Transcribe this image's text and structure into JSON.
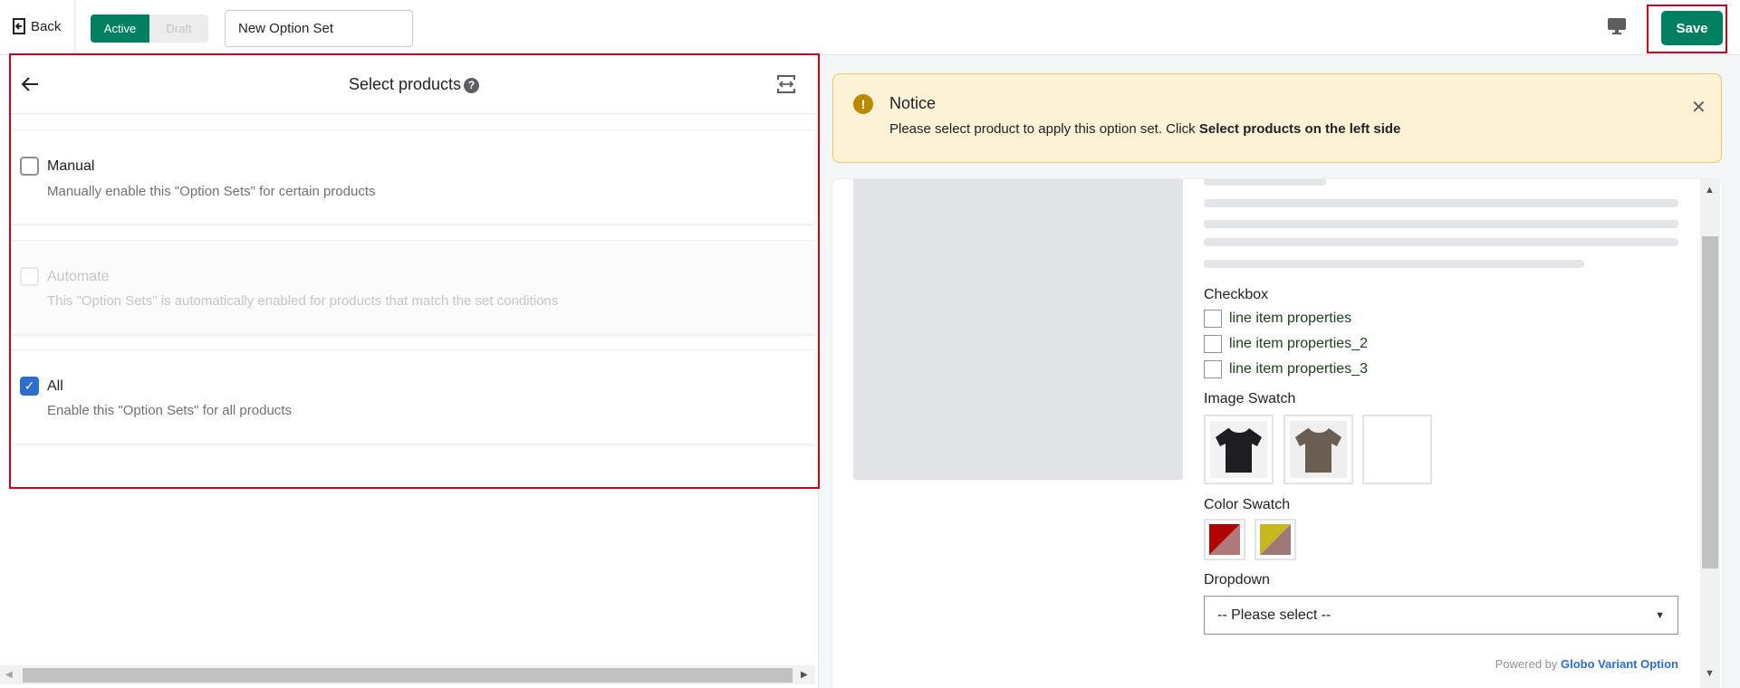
{
  "topbar": {
    "back_label": "Back",
    "status_toggle": {
      "active_label": "Active",
      "draft_label": "Draft",
      "selected": "Active"
    },
    "name_input_value": "New Option Set",
    "save_label": "Save",
    "accent_color": "#008060"
  },
  "left_panel": {
    "title": "Select products",
    "options": [
      {
        "label": "Manual",
        "description": "Manually enable this \"Option Sets\" for certain products",
        "checked": false,
        "disabled": false
      },
      {
        "label": "Automate",
        "description": "This \"Option Sets\" is automatically enabled for products that match the set conditions",
        "checked": false,
        "disabled": true
      },
      {
        "label": "All",
        "description": "Enable this \"Option Sets\" for all products",
        "checked": true,
        "disabled": false
      }
    ]
  },
  "notice": {
    "title": "Notice",
    "text": "Please select product to apply this option set. Click ",
    "text_bold": "Select products on the left side"
  },
  "preview": {
    "checkbox_title": "Checkbox",
    "checkbox_items": [
      "line item properties",
      "line item properties_2",
      "line item properties_3"
    ],
    "image_swatch_title": "Image Swatch",
    "color_swatch_title": "Color Swatch",
    "color_swatches": [
      [
        "#b00000",
        "#b07878"
      ],
      [
        "#c8b820",
        "#a07878"
      ]
    ],
    "dropdown_title": "Dropdown",
    "dropdown_value": "-- Please select --",
    "powered_by": "Powered by ",
    "powered_brand": "Globo Variant Option"
  }
}
